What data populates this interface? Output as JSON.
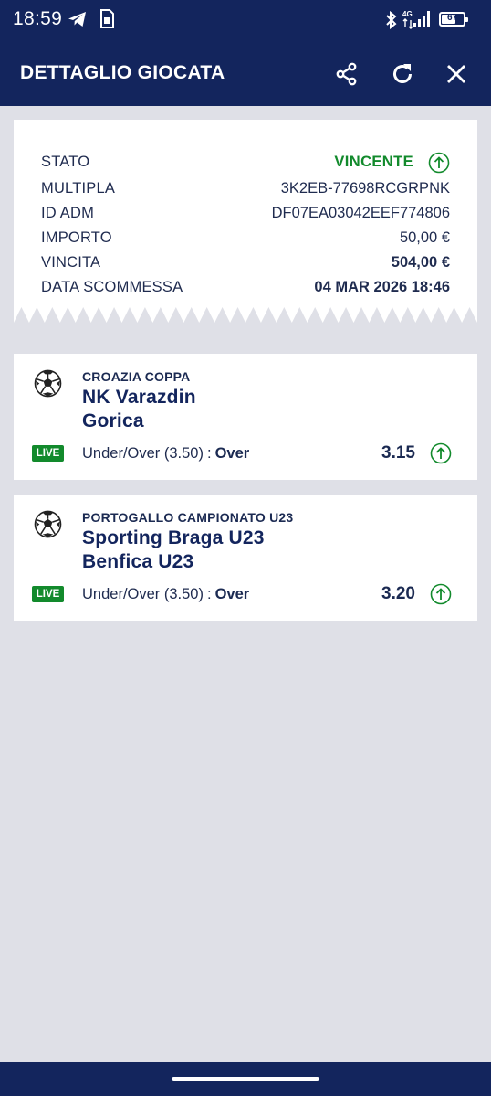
{
  "status_bar": {
    "time": "18:59",
    "network": "4G",
    "battery": "67",
    "battery_level": 0.67
  },
  "header": {
    "title": "DETTAGLIO GIOCATA",
    "icons": [
      "share-icon",
      "refresh-icon",
      "close-icon"
    ]
  },
  "details": {
    "rows": [
      {
        "label": "STATO",
        "value": "VINCENTE"
      },
      {
        "label": "MULTIPLA",
        "value": "3K2EB-77698RCGRPNK"
      },
      {
        "label": "ID ADM",
        "value": "DF07EA03042EEF774806"
      },
      {
        "label": "IMPORTO",
        "value": "50,00 €"
      },
      {
        "label": "VINCITA",
        "value": "504,00 €"
      },
      {
        "label": "DATA SCOMMESSA",
        "value": "04 MAR 2026 18:46"
      }
    ]
  },
  "bets": [
    {
      "league": "CROAZIA COPPA",
      "home": "NK Varazdin",
      "away": "Gorica",
      "live": "LIVE",
      "market": "Under/Over (3.50)",
      "separator": ":",
      "selection": "Over",
      "odd": "3.15"
    },
    {
      "league": "PORTOGALLO CAMPIONATO U23",
      "home": "Sporting Braga U23",
      "away": "Benfica U23",
      "live": "LIVE",
      "market": "Under/Over (3.50)",
      "separator": ":",
      "selection": "Over",
      "odd": "3.20"
    }
  ],
  "colors": {
    "navy": "#13255d",
    "green": "#128a2c",
    "background": "#dfe0e7"
  }
}
